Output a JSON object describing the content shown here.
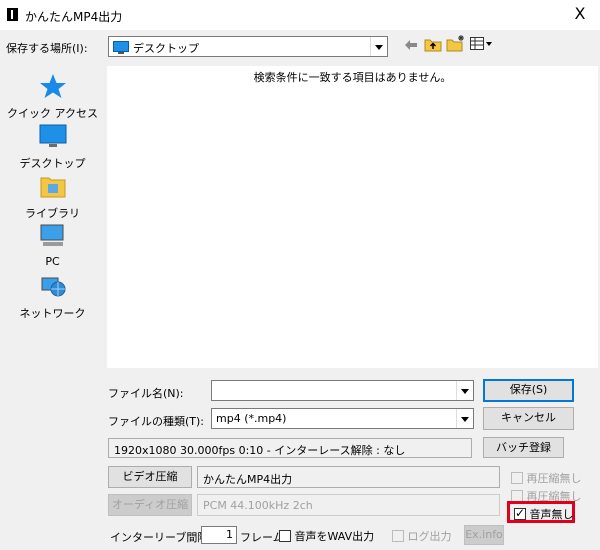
{
  "window": {
    "title": "かんたんMP4出力",
    "close_glyph": "X"
  },
  "location": {
    "label": "保存する場所(I):",
    "value": "デスクトップ"
  },
  "toolbar": {
    "back": "back-arrow-icon",
    "up": "up-folder-icon",
    "newfolder": "new-folder-icon",
    "view": "view-menu-icon"
  },
  "places": [
    {
      "label": "クイック アクセス",
      "icon": "star-icon"
    },
    {
      "label": "デスクトップ",
      "icon": "desktop-icon"
    },
    {
      "label": "ライブラリ",
      "icon": "library-icon"
    },
    {
      "label": "PC",
      "icon": "pc-icon"
    },
    {
      "label": "ネットワーク",
      "icon": "network-icon"
    }
  ],
  "filelist": {
    "empty_message": "検索条件に一致する項目はありません。"
  },
  "filename": {
    "label": "ファイル名(N):",
    "value": ""
  },
  "filetype": {
    "label": "ファイルの種類(T):",
    "value": "mp4 (*.mp4)"
  },
  "buttons": {
    "save": "保存(S)",
    "cancel": "キャンセル",
    "batch": "バッチ登録",
    "video": "ビデオ圧縮",
    "audio": "オーディオ圧縮",
    "exinfo": "Ex.info"
  },
  "info": {
    "text": "1920x1080  30.000fps  0:10  -  インターレース解除 : なし"
  },
  "video_codec": {
    "value": "かんたんMP4出力"
  },
  "audio_codec": {
    "value": "PCM 44.100kHz 2ch"
  },
  "checks": {
    "recompress_none_1": {
      "label": "再圧縮無し",
      "checked": false,
      "enabled": false
    },
    "recompress_none_2": {
      "label": "再圧縮無し",
      "checked": false,
      "enabled": false
    },
    "no_audio": {
      "label": "音声無し",
      "checked": true,
      "enabled": true
    },
    "audio_wav": {
      "label": "音声をWAV出力",
      "checked": false,
      "enabled": true
    },
    "log_output": {
      "label": "ログ出力",
      "checked": false,
      "enabled": false
    }
  },
  "interleave": {
    "label": "インターリーブ間隔 :",
    "value": "1",
    "unit": "フレーム"
  },
  "colors": {
    "highlight": "#e0001b",
    "accent": "#0078d7"
  }
}
